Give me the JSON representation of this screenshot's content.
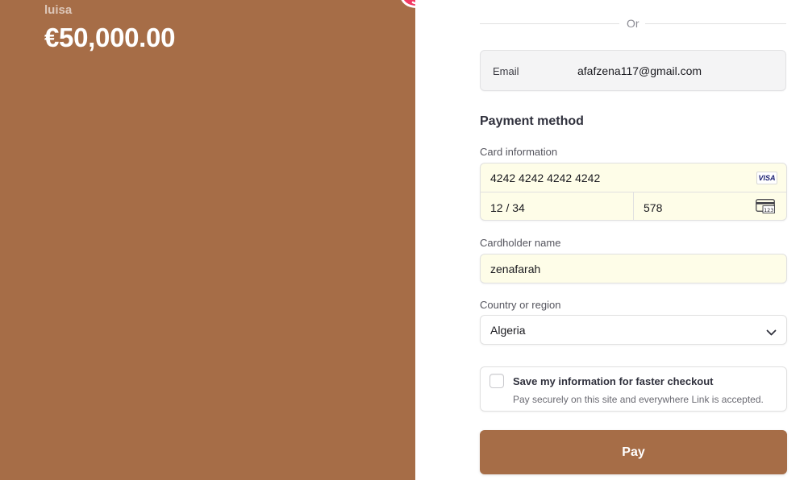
{
  "summary": {
    "merchant_name": "luisa",
    "amount": "€50,000.00",
    "brand_color": "#a66d47"
  },
  "logo": {
    "icon": "link-logo-icon",
    "color": "#f23a63"
  },
  "divider": {
    "text": "Or"
  },
  "email": {
    "label": "Email",
    "value": "afafzena117@gmail.com"
  },
  "payment": {
    "title": "Payment method",
    "card_label": "Card information",
    "card_number": "4242 4242 4242 4242",
    "card_brand": "VISA",
    "expiry": "12 / 34",
    "cvc": "578",
    "cvc_icon": "card-cvc-icon",
    "cvc_icon_text": "123",
    "cardholder_label": "Cardholder name",
    "cardholder_value": "zenafarah",
    "country_label": "Country or region",
    "country_value": "Algeria"
  },
  "save_info": {
    "title": "Save my information for faster checkout",
    "subtitle": "Pay securely on this site and everywhere Link is accepted.",
    "checked": false
  },
  "pay_button": {
    "label": "Pay"
  }
}
